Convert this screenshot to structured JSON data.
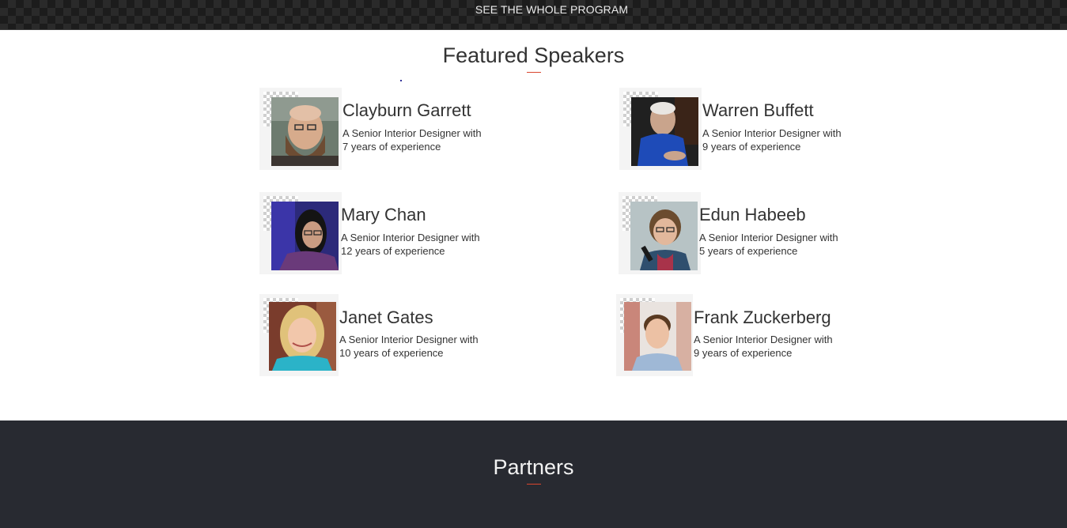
{
  "topbar": {
    "program_link": "SEE THE WHOLE PROGRAM"
  },
  "featured": {
    "title": "Featured Speakers",
    "speakers": [
      {
        "name": "Clayburn Garrett",
        "desc": "A Senior Interior Designer with 7 years of experience"
      },
      {
        "name": "Warren Buffett",
        "desc": "A Senior Interior Designer with 9 years of experience"
      },
      {
        "name": "Mary Chan",
        "desc": "A Senior Interior Designer with 12 years of experience"
      },
      {
        "name": "Edun Habeeb",
        "desc": "A Senior Interior Designer with 5 years of experience"
      },
      {
        "name": "Janet Gates",
        "desc": "A Senior Interior Designer with 10 years of experience"
      },
      {
        "name": "Frank Zuckerberg",
        "desc": "A Senior Interior Designer with 9 years of experience"
      }
    ]
  },
  "partners": {
    "title": "Partners"
  },
  "colors": {
    "accent": "#d9462e",
    "dark_section": "#282a31",
    "text": "#333333"
  }
}
